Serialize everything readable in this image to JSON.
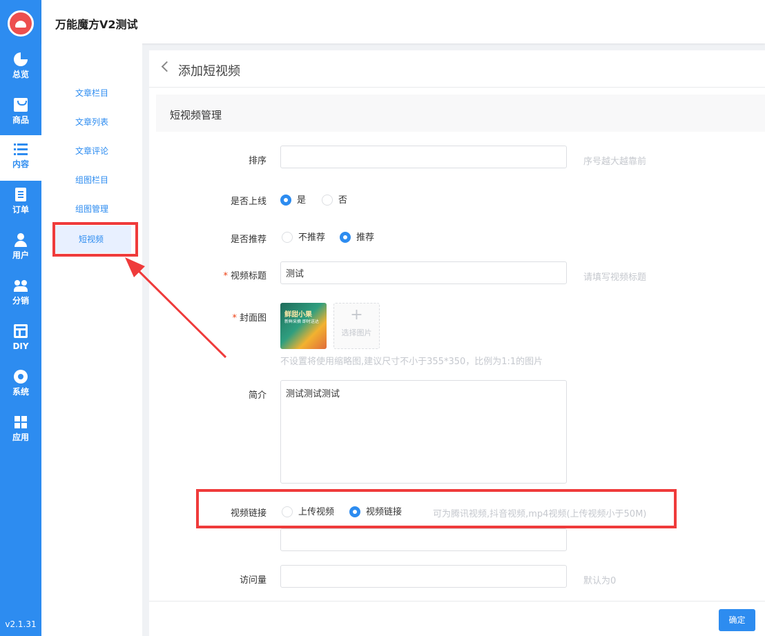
{
  "app": {
    "title": "万能魔方V2测试",
    "version": "v2.1.31"
  },
  "rail": [
    {
      "label": "总览",
      "icon": "pie-chart-icon"
    },
    {
      "label": "商品",
      "icon": "shopping-bag-icon"
    },
    {
      "label": "内容",
      "icon": "list-icon"
    },
    {
      "label": "订单",
      "icon": "document-icon"
    },
    {
      "label": "用户",
      "icon": "user-icon"
    },
    {
      "label": "分销",
      "icon": "users-icon"
    },
    {
      "label": "DIY",
      "icon": "layout-icon"
    },
    {
      "label": "系统",
      "icon": "gear-icon"
    },
    {
      "label": "应用",
      "icon": "grid-icon"
    }
  ],
  "subnav": [
    "文章栏目",
    "文章列表",
    "文章评论",
    "组图栏目",
    "组图管理",
    "短视频"
  ],
  "page": {
    "title": "添加短视频",
    "section": "短视频管理"
  },
  "form": {
    "sort": {
      "label": "排序",
      "value": "",
      "hint": "序号越大越靠前"
    },
    "online": {
      "label": "是否上线",
      "yes": "是",
      "no": "否",
      "selected": "是"
    },
    "recommend": {
      "label": "是否推荐",
      "no": "不推荐",
      "yes": "推荐",
      "selected": "推荐"
    },
    "video_title": {
      "label": "视频标题",
      "value": "测试",
      "hint": "请填写视频标题"
    },
    "cover": {
      "label": "封面图",
      "picker_label": "选择图片",
      "tip": "不设置将使用缩略图,建议尺寸不小于355*350，比例为1:1的图片",
      "thumb_line1": "鲜甜小果",
      "thumb_line2": "新鲜采摘 即时送达"
    },
    "intro": {
      "label": "简介",
      "value": "测试测试测试"
    },
    "video_link": {
      "label": "视频链接",
      "upload": "上传视频",
      "link": "视频链接",
      "selected": "视频链接",
      "hint": "可为腾讯视频,抖音视频,mp4视频(上传视频小于50M)",
      "value": ""
    },
    "visits": {
      "label": "访问量",
      "value": "",
      "hint": "默认为0"
    }
  },
  "footer": {
    "confirm": "确定"
  },
  "annotation": {
    "color": "#ef3b3b"
  }
}
